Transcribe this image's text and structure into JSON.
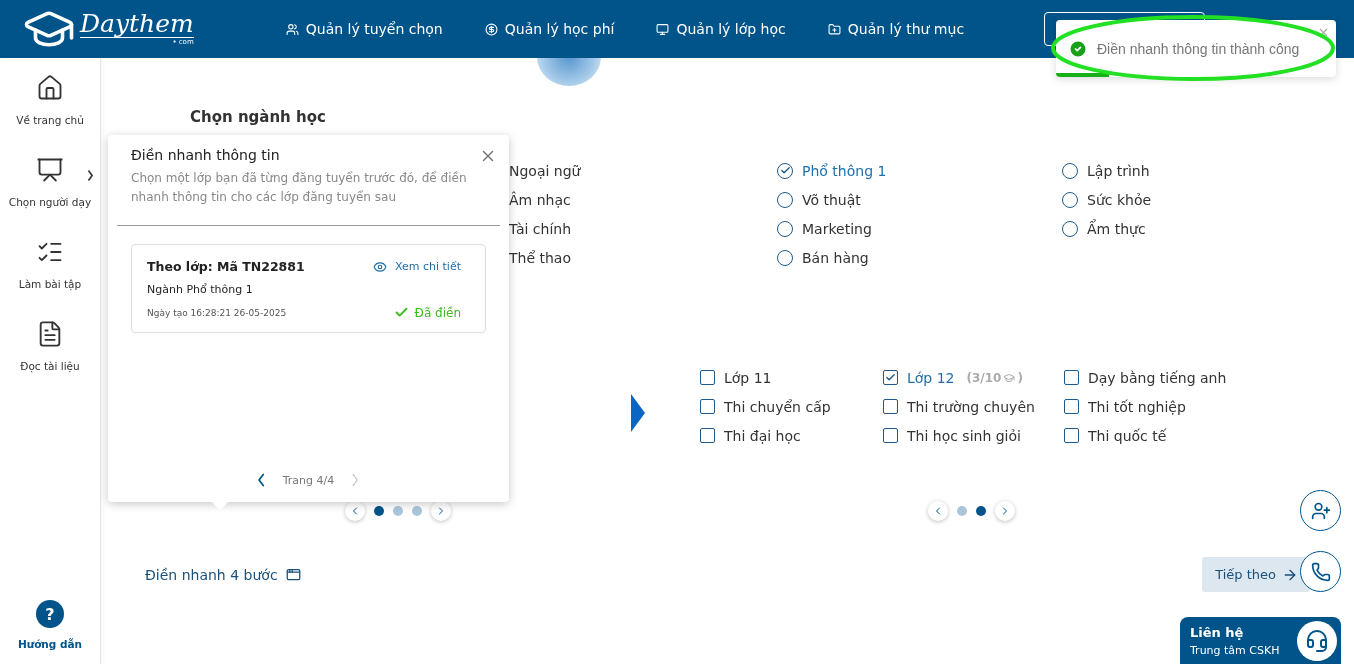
{
  "header": {
    "logo": {
      "name": "Daythem",
      "suffix": "• com"
    },
    "nav": [
      {
        "label": "Quản lý tuyển chọn",
        "kind": "recruit"
      },
      {
        "label": "Quản lý học phí",
        "kind": "fee"
      },
      {
        "label": "Quản lý lớp học",
        "kind": "class"
      },
      {
        "label": "Quản lý thư mục",
        "kind": "folder"
      }
    ]
  },
  "sidebar": {
    "items": [
      {
        "label": "Về trang chủ",
        "kind": "home",
        "expandable": false
      },
      {
        "label": "Chọn người dạy",
        "kind": "teacher",
        "expandable": true
      },
      {
        "label": "Làm bài tập",
        "kind": "exercise",
        "expandable": false
      },
      {
        "label": "Đọc tài liệu",
        "kind": "pdf",
        "expandable": false
      }
    ],
    "help": {
      "icon": "?",
      "label": "Hướng dẫn"
    }
  },
  "majors": {
    "title": "Chọn ngành học",
    "items": [
      {
        "label": "Ngoại ngữ",
        "kind": "plain"
      },
      {
        "label": "Phổ thông 1",
        "kind": "radio",
        "selected": true
      },
      {
        "label": "Lập trình",
        "kind": "radio",
        "selected": false
      },
      {
        "label": "Âm nhạc",
        "kind": "plain"
      },
      {
        "label": "Võ thuật",
        "kind": "radio",
        "selected": false
      },
      {
        "label": "Sức khỏe",
        "kind": "radio",
        "selected": false
      },
      {
        "label": "Tài chính",
        "kind": "plain"
      },
      {
        "label": "Marketing",
        "kind": "radio",
        "selected": false
      },
      {
        "label": "Ẩm thực",
        "kind": "radio",
        "selected": false
      },
      {
        "label": "Thể thao",
        "kind": "plain"
      },
      {
        "label": "Bán hàng",
        "kind": "radio",
        "selected": false
      }
    ]
  },
  "left_pager": [
    {
      "selected": true
    },
    {
      "selected": false
    },
    {
      "selected": false
    }
  ],
  "classes": {
    "items": [
      {
        "label": "Lớp 11",
        "checked": false
      },
      {
        "label": "Lớp 12",
        "checked": true,
        "note_open": "(3/10",
        "note_close": ")"
      },
      {
        "label": "Dạy bằng tiếng anh",
        "checked": false
      },
      {
        "label": "Thi chuyển cấp",
        "checked": false
      },
      {
        "label": "Thi trường chuyên",
        "checked": false
      },
      {
        "label": "Thi tốt nghiệp",
        "checked": false
      },
      {
        "label": "Thi đại học",
        "checked": false
      },
      {
        "label": "Thi học sinh giỏi",
        "checked": false
      },
      {
        "label": "Thi quốc tế",
        "checked": false
      }
    ]
  },
  "right_pager": [
    {
      "selected": false
    },
    {
      "selected": true
    }
  ],
  "footer": {
    "quick_fill": "Điền nhanh 4 bước",
    "next": "Tiếp theo"
  },
  "popover": {
    "title": "Điền nhanh thông tin",
    "description": "Chọn một lớp bạn đã từng đăng tuyển trước đó, để điền nhanh thông tin cho các lớp đăng tuyển sau",
    "card": {
      "title": "Theo lớp: Mã TN22881",
      "view": "Xem chi tiết",
      "major": "Ngành Phổ thông 1",
      "created": "Ngày tạo 16:28:21 26-05-2025",
      "status": "Đã điền"
    },
    "page": "Trang 4/4",
    "next_disabled": true
  },
  "toast": {
    "message": "Điền nhanh thông tin thành công",
    "level": 0.19
  },
  "contact": {
    "title": "Liên hệ",
    "subtitle": "Trung tâm CSKH"
  }
}
